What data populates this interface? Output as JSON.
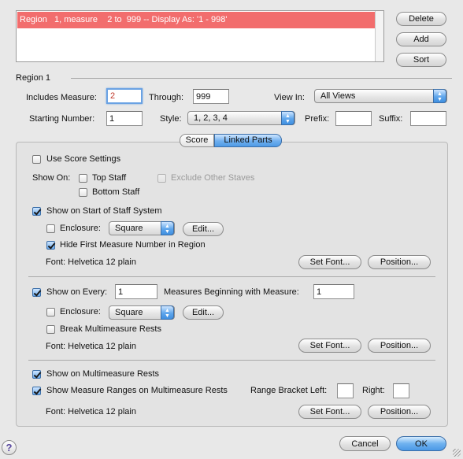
{
  "regions": {
    "items": [
      "Region   1, measure    2 to  999 -- Display As: '1 - 998'"
    ]
  },
  "side_buttons": {
    "delete": "Delete",
    "add": "Add",
    "sort": "Sort"
  },
  "region_header": "Region 1",
  "includes_measure": {
    "label": "Includes Measure:",
    "value": "2"
  },
  "through": {
    "label": "Through:",
    "value": "999"
  },
  "view_in": {
    "label": "View In:",
    "value": "All Views"
  },
  "starting_number": {
    "label": "Starting Number:",
    "value": "1"
  },
  "style": {
    "label": "Style:",
    "value": "1, 2, 3, 4"
  },
  "prefix": {
    "label": "Prefix:",
    "value": ""
  },
  "suffix": {
    "label": "Suffix:",
    "value": ""
  },
  "tabs": {
    "score": "Score",
    "linked_parts": "Linked Parts",
    "selected": "Linked Parts"
  },
  "use_score_settings": {
    "label": "Use Score Settings",
    "checked": false
  },
  "show_on": {
    "label": "Show On:",
    "top_staff": {
      "label": "Top Staff",
      "checked": false
    },
    "exclude_other_staves": {
      "label": "Exclude Other Staves",
      "checked": false,
      "disabled": true
    },
    "bottom_staff": {
      "label": "Bottom Staff",
      "checked": false
    }
  },
  "section1": {
    "show_on_start": {
      "label": "Show on Start of Staff System",
      "checked": true
    },
    "enclosure": {
      "label": "Enclosure:",
      "value": "Square",
      "checked": false
    },
    "edit": "Edit...",
    "hide_first": {
      "label": "Hide First Measure Number in Region",
      "checked": true
    },
    "font": "Font:  Helvetica 12 plain",
    "set_font": "Set Font...",
    "position": "Position..."
  },
  "section2": {
    "show_every": {
      "label": "Show on Every:",
      "checked": true,
      "value": "1"
    },
    "beginning": {
      "label": "Measures Beginning with Measure:",
      "value": "1"
    },
    "enclosure": {
      "label": "Enclosure:",
      "value": "Square",
      "checked": false
    },
    "edit": "Edit...",
    "break_rests": {
      "label": "Break Multimeasure Rests",
      "checked": false
    },
    "font": "Font:  Helvetica 12 plain",
    "set_font": "Set Font...",
    "position": "Position..."
  },
  "section3": {
    "show_on_mm": {
      "label": "Show on Multimeasure Rests",
      "checked": true
    },
    "show_ranges": {
      "label": "Show Measure Ranges on Multimeasure Rests",
      "checked": true
    },
    "range_left": {
      "label": "Range Bracket Left:",
      "value": ""
    },
    "range_right": {
      "label": "Right:",
      "value": ""
    },
    "font": "Font:  Helvetica 12 plain",
    "set_font": "Set Font...",
    "position": "Position..."
  },
  "footer": {
    "help": "?",
    "cancel": "Cancel",
    "ok": "OK"
  },
  "colors": {
    "selection": "#f26d6d",
    "accent": "#4b98e6"
  }
}
